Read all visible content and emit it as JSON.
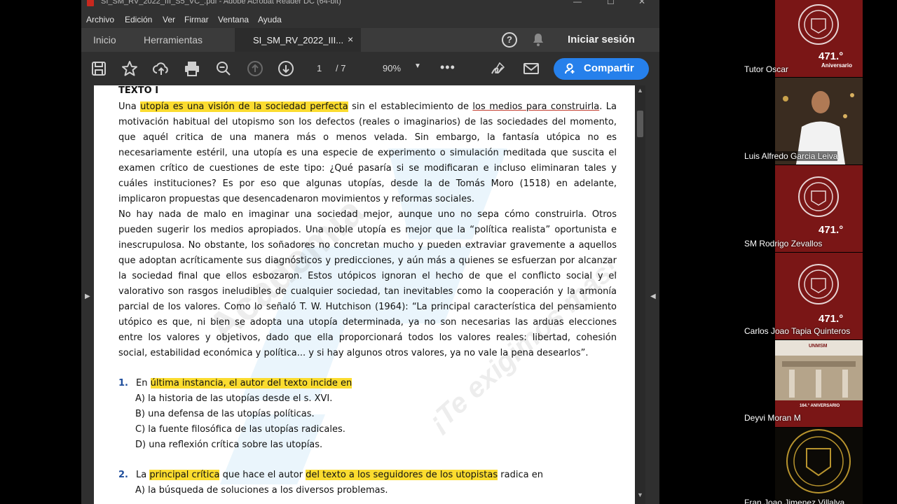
{
  "window": {
    "title": "SI_SM_RV_2022_III_S5_VC_.pdf - Adobe Acrobat Reader DC (64-bit)",
    "minimize": "—",
    "maximize": "☐",
    "close": "✕"
  },
  "menu": {
    "items": [
      "Archivo",
      "Edición",
      "Ver",
      "Firmar",
      "Ventana",
      "Ayuda"
    ]
  },
  "tabs": {
    "home": "Inicio",
    "tools": "Herramientas",
    "document": "SI_SM_RV_2022_III...",
    "close": "×",
    "signin": "Iniciar sesión"
  },
  "toolbar": {
    "page_current": "1",
    "page_total": "/ 7",
    "zoom": "90%",
    "more": "•••",
    "share_label": "Compartir",
    "icons": [
      "save-icon",
      "star-icon",
      "upload-icon",
      "print-icon",
      "zoom-out-icon",
      "page-up-icon",
      "page-down-icon",
      "sign-icon",
      "email-icon"
    ]
  },
  "document": {
    "watermark": {
      "brand": "Academia",
      "slogan": "¡Te exigimos más!"
    },
    "heading": "TEXTO I",
    "p1_line1": {
      "a": "Una ",
      "hl": "utopía es una visión de la sociedad perfecta",
      "b": " sin el establecimiento de ",
      "ul": "los medios para construirla",
      "c": ". La"
    },
    "lines": [
      "motivación habitual del utopismo son los defectos (reales o imaginarios) de las sociedades del momento,",
      "que aquél critica de una manera más o menos velada. Sin embargo, la fantasía utópica no es",
      "necesariamente estéril, una utopía es una especie de experimento o simulación meditada que suscita el",
      "examen crítico de cuestiones de este tipo: ¿Qué pasaría si se modificaran e incluso eliminaran tales y",
      "cuáles instituciones? Es por eso que algunas utopías, desde la de Tomás Moro (1518) en adelante,",
      "implicaron propuestas que desencadenaron movimientos y reformas sociales.",
      "No hay nada de malo en imaginar una sociedad mejor, aunque uno no sepa cómo construirla. Otros",
      "pueden sugerir los medios apropiados. Una noble utopía es mejor que la “política realista” oportunista e",
      "inescrupulosa. No obstante, los soñadores no concretan mucho y pueden extraviar gravemente a aquellos",
      "que adoptan acríticamente sus diagnósticos y predicciones, y aún más a quienes se esfuerzan por alcanzar",
      "la sociedad final que ellos esbozaron. Estos utópicos ignoran el hecho de que el conflicto social y el",
      "valorativo son rasgos ineludibles de cualquier sociedad, tan inevitables como la cooperación y la armonía",
      "parcial de los valores. Como lo señaló T. W. Hutchison (1964): “La principal característica del pensamiento",
      "utópico es que, ni bien se adopta una utopía determinada, ya no son necesarias las arduas elecciones",
      "entre los valores y objetivos, dado que ella proporcionará todos los valores reales: libertad, cohesión",
      "social, estabilidad económica y política... y si hay algunos otros valores, ya no vale la pena desearlos”."
    ],
    "q1": {
      "number": "1.",
      "a": "En ",
      "hl": "última instancia, el autor del texto incide en",
      "options": [
        "A)  la historia de las utopías desde el s. XVI.",
        "B)  una defensa de las utopías políticas.",
        "C)  la fuente filosófica de las utopías radicales.",
        "D)  una reflexión crítica sobre las utopías."
      ]
    },
    "q2": {
      "number": "2.",
      "a": "La ",
      "hl1": "principal crítica",
      "b": " que hace el autor ",
      "hl2": "del texto a los seguidores de los utopistas",
      "c": " radica en",
      "options": [
        "A)  la búsqueda de soluciones a los diversos problemas."
      ]
    }
  },
  "participants": [
    {
      "name": "Tutor Oscar",
      "kind": "logo",
      "badge": "471.°",
      "badge_sub": "Aniversario"
    },
    {
      "name": "Luis Alfredo Garcia Leiva",
      "kind": "camera"
    },
    {
      "name": "SM Rodrigo Zevallos",
      "kind": "logo",
      "badge": "471.°"
    },
    {
      "name": "Carlos Joao Tapia Quinteros",
      "kind": "logo",
      "badge": "471.°"
    },
    {
      "name": "Deyvi Moran M",
      "kind": "poster",
      "poster_top": "UNMSM",
      "poster_text": "164.° ANIVERSARIO"
    },
    {
      "name": "Fran Joao Jimenez Villalva",
      "kind": "crest"
    }
  ],
  "colors": {
    "highlight": "#fbdc2f",
    "share_button": "#2680eb",
    "logo_tile": "#7a1616",
    "question_number": "#1f4e9c"
  }
}
